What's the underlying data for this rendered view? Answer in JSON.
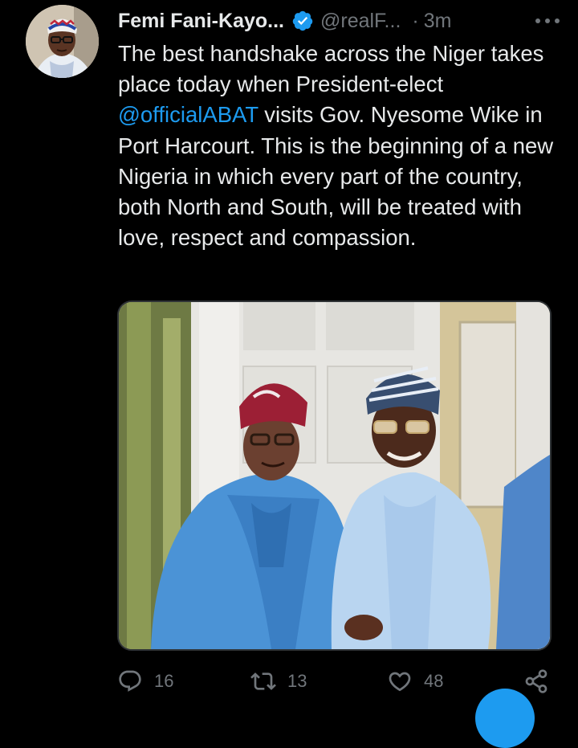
{
  "author": {
    "name": "Femi Fani-Kayo...",
    "handle": "@realF...",
    "separator": "·",
    "time": "3m"
  },
  "tweet": {
    "text_before": "The best handshake across the Niger takes place today when President-elect ",
    "mention": "@officialABAT",
    "text_after": " visits Gov. Nyesome Wike in Port Harcourt. This is the beginning of a new Nigeria in which every part of the country, both North and South, will be treated with love, respect and compassion."
  },
  "actions": {
    "replies": "16",
    "retweets": "13",
    "likes": "48"
  },
  "icons": {
    "verified": "verified-badge-icon",
    "more": "more-options-icon",
    "reply": "reply-icon",
    "retweet": "retweet-icon",
    "like": "heart-icon",
    "share": "share-icon"
  },
  "colors": {
    "background": "#000000",
    "text": "#e7e9ea",
    "muted": "#71767b",
    "accent": "#1d9bf0"
  }
}
